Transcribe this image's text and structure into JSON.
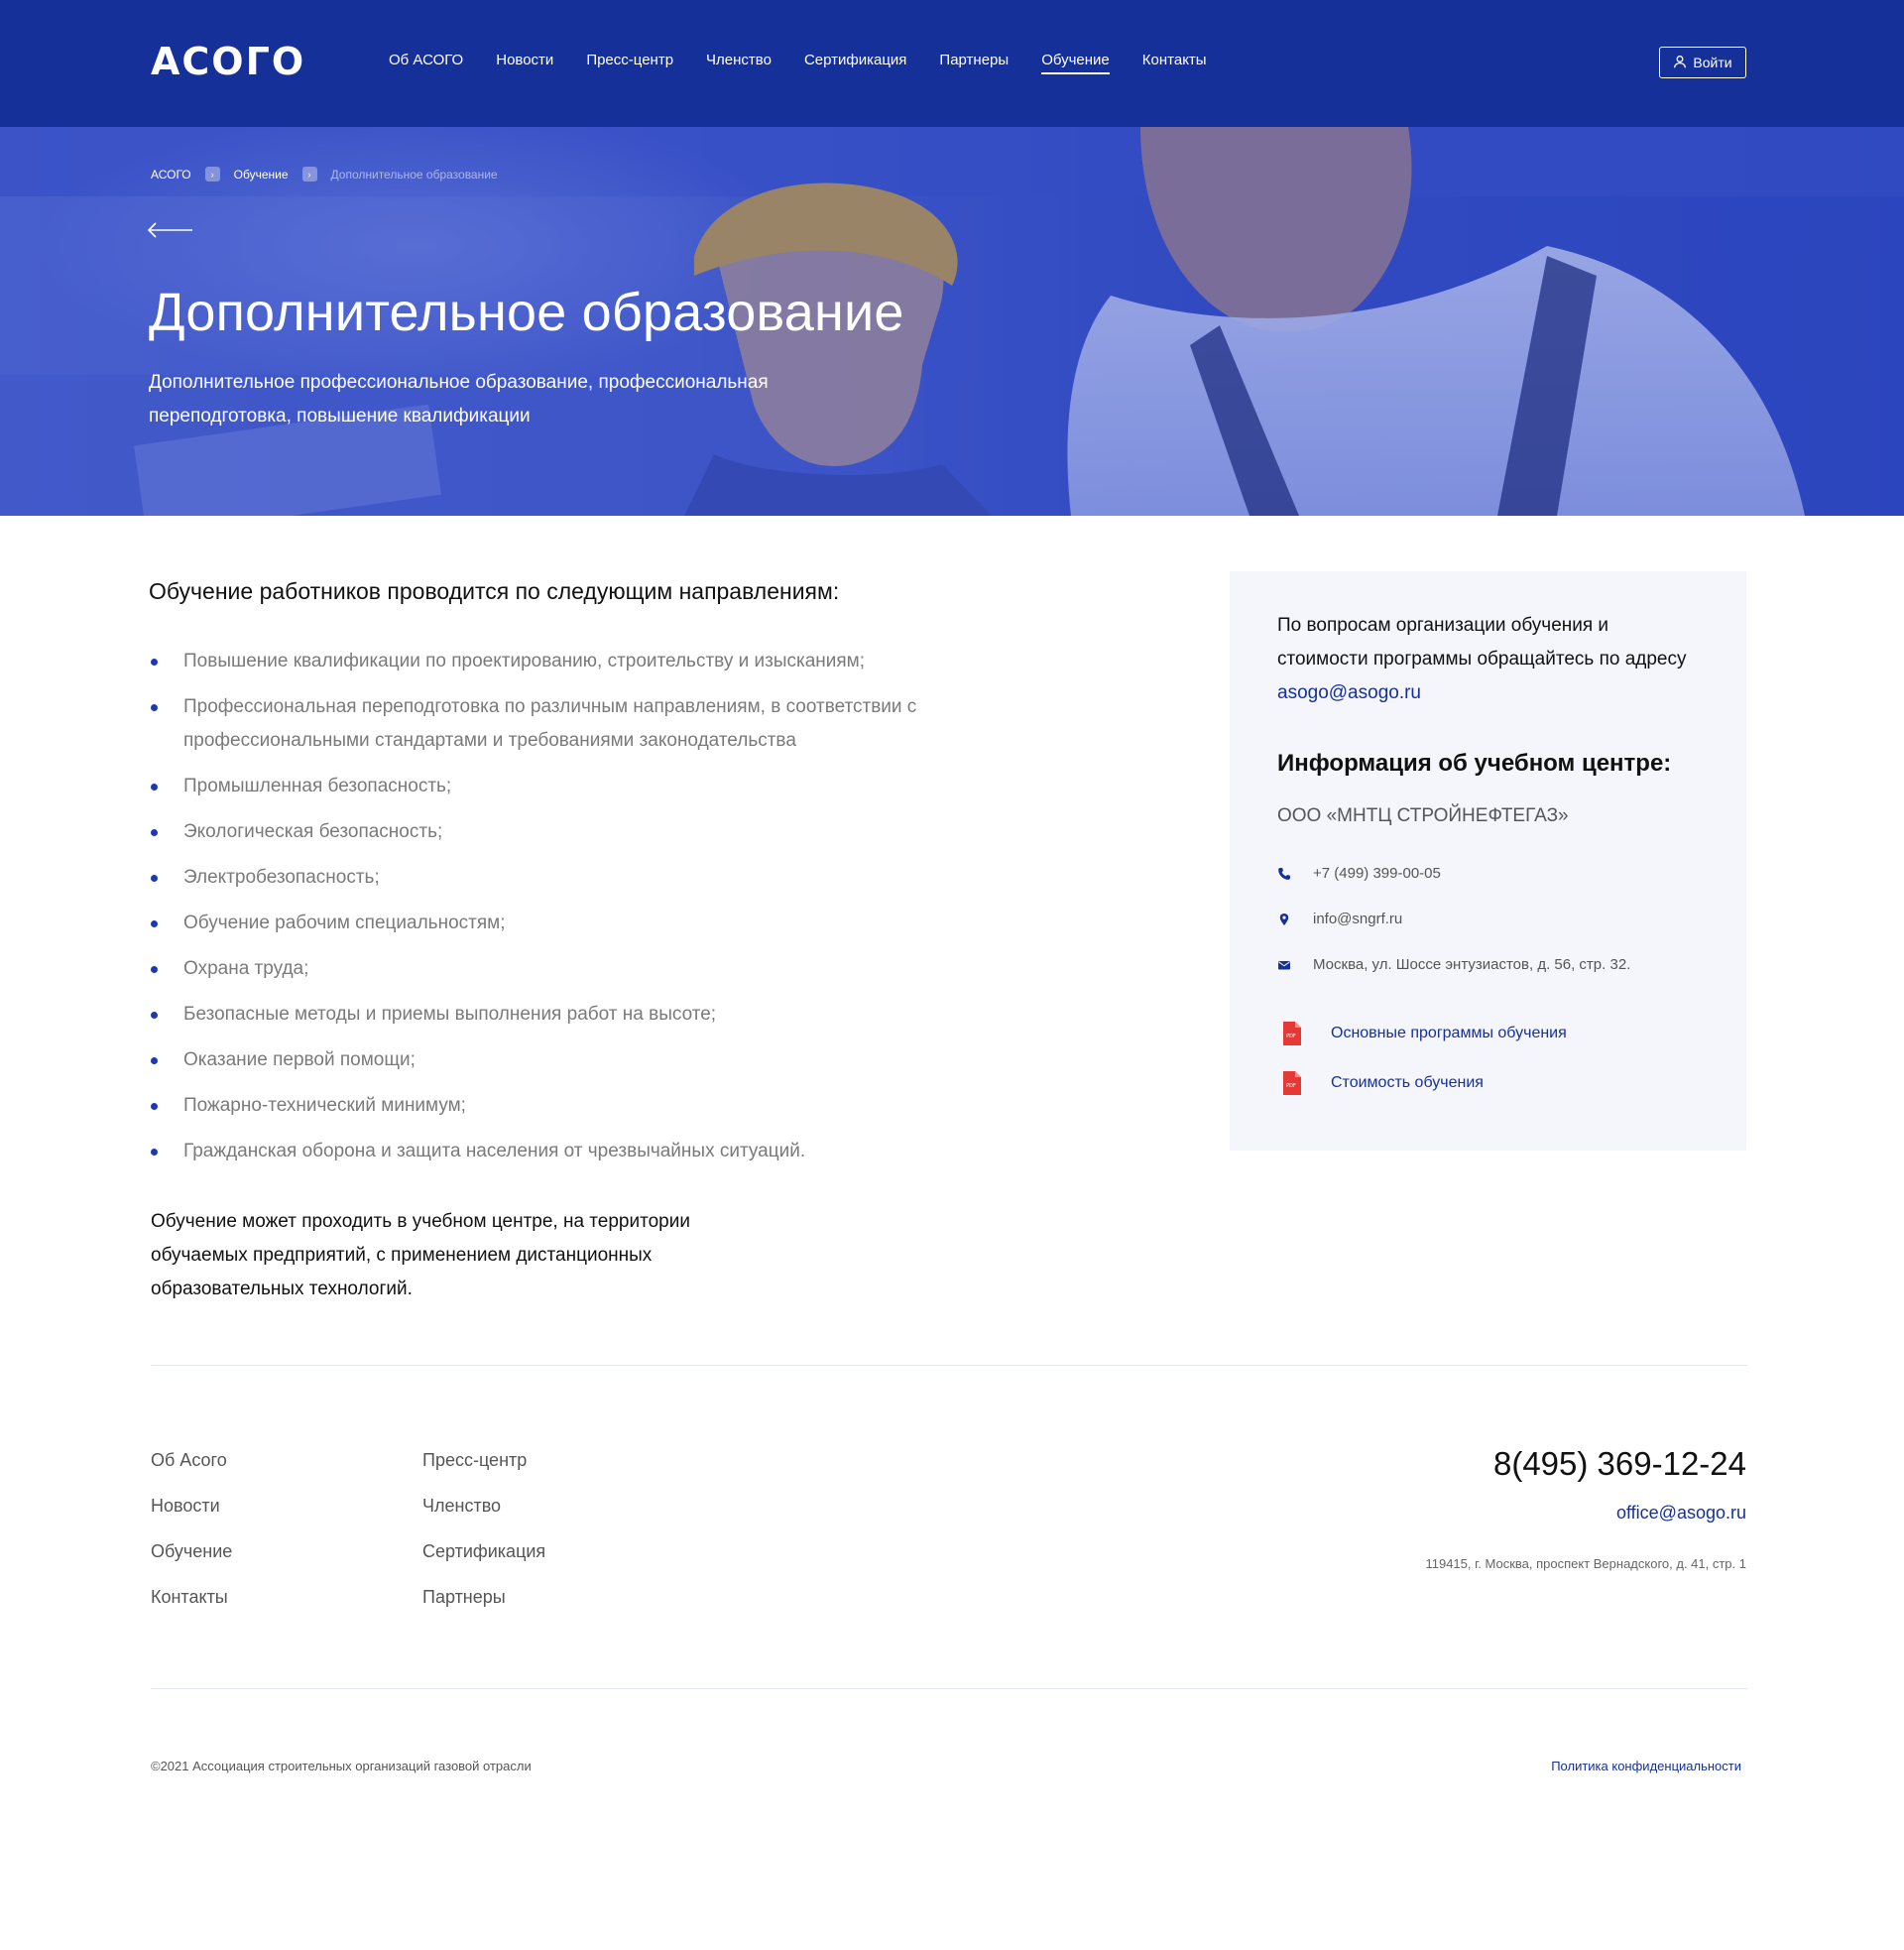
{
  "header": {
    "logo": "АСОГО",
    "nav": [
      "Об АСОГО",
      "Новости",
      "Пресс-центр",
      "Членство",
      "Сертификация",
      "Партнеры",
      "Обучение",
      "Контакты"
    ],
    "active_nav": "Обучение",
    "login_label": "Войти"
  },
  "hero": {
    "breadcrumb": [
      "АСОГО",
      "Обучение",
      "Дополнительное образование"
    ],
    "title": "Дополнительное образование",
    "subtitle": "Дополнительное профессиональное образование, профессиональная переподготовка, повышение квалификации"
  },
  "main": {
    "intro": "Обучение работников проводится по следующим направлениям:",
    "directions": [
      "Повышение квалификации по проектированию, строительству и изысканиям;",
      "Профессиональная переподготовка по различным направлениям, в соответствии с профессиональными стандартами и требованиями законодательства",
      "Промышленная безопасность;",
      "Экологическая безопасность;",
      "Электробезопасность;",
      "Обучение рабочим специальностям;",
      "Охрана труда;",
      "Безопасные методы и приемы выполнения работ на высоте;",
      "Оказание первой помощи;",
      "Пожарно-технический минимум;",
      "Гражданская оборона и защита населения от чрезвычайных ситуаций."
    ],
    "outro": "Обучение может проходить в учебном центре, на территории обучаемых предприятий, с применением дистанционных образовательных технологий."
  },
  "sidebar": {
    "question_text": "По вопросам организации обучения и стоимости программы обращайтесь по адресу",
    "question_email": "asogo@asogo.ru",
    "heading": "Информация об учебном центре:",
    "org": "ООО «МНТЦ СТРОЙНЕФТЕГАЗ»",
    "phone": "+7 (499) 399-00-05",
    "email": "info@sngrf.ru",
    "address": "Москва, ул. Шоссе энтузиастов, д. 56, стр. 32.",
    "docs": [
      "Основные программы обучения",
      "Стоимость обучения"
    ]
  },
  "footer": {
    "col1": [
      "Об Асого",
      "Новости",
      "Обучение",
      "Контакты"
    ],
    "col2": [
      "Пресс-центр",
      "Членство",
      "Сертификация",
      "Партнеры"
    ],
    "phone": "8(495) 369-12-24",
    "email": "office@asogo.ru",
    "address": "119415, г. Москва, проспект Вернадского, д. 41, стр. 1",
    "copyright": "©2021 Ассоциация строительных организаций газовой отрасли",
    "policy": "Политика конфиденциальности"
  },
  "colors": {
    "brand": "#16309a",
    "bullet": "#1c3aaa",
    "sidebar_bg": "#f4f6fb",
    "pdf_red": "#e53935"
  }
}
